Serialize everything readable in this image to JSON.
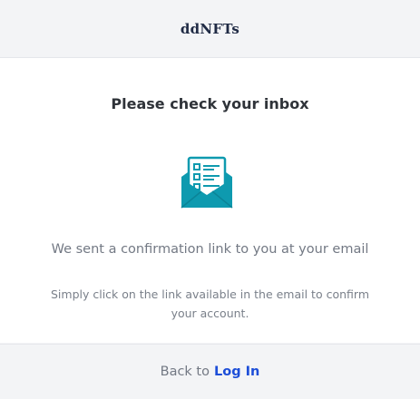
{
  "header": {
    "logo_text": "ddNFTs"
  },
  "card": {
    "title": "Please check your inbox",
    "subtitle": "We sent a confirmation link to you at your email",
    "description": "Simply click on the link available in the email to confirm your account.",
    "icon": "envelope-letter-icon",
    "icon_color": "#0e9aaf"
  },
  "footer": {
    "prefix": "Back to",
    "link_label": "Log In",
    "link_color": "#1d4ed8"
  }
}
